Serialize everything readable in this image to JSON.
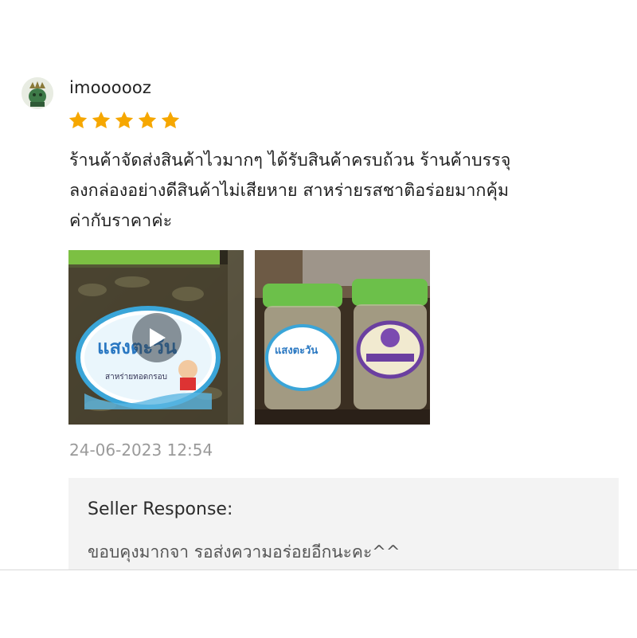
{
  "review": {
    "username": "imoooooz",
    "rating": 5,
    "text_lines": [
      "ร้านค้าจัดส่งสินค้าไวมากๆ ได้รับสินค้าครบถ้วน ร้านค้าบรรจุ",
      "ลงกล่องอย่างดีสินค้าไม่เสียหาย สาหร่ายรสชาติอร่อยมากคุ้ม",
      "ค่ากับราคาค่ะ"
    ],
    "timestamp": "24-06-2023 12:54"
  },
  "media": [
    {
      "type": "video",
      "label_text": "แสงตะวัน",
      "sub_text": "สาหร่ายทอดกรอบ"
    },
    {
      "type": "image",
      "label_text": "แสงตะวัน"
    }
  ],
  "seller_response": {
    "title": "Seller Response:",
    "text": "ขอบคุงมากจา รอส่งความอร่อยอีกนะคะ^^"
  },
  "colors": {
    "star": "#f6a700",
    "lid_green": "#6cc04a",
    "timestamp": "#9a9a9a",
    "seller_bg": "#f3f3f3"
  }
}
